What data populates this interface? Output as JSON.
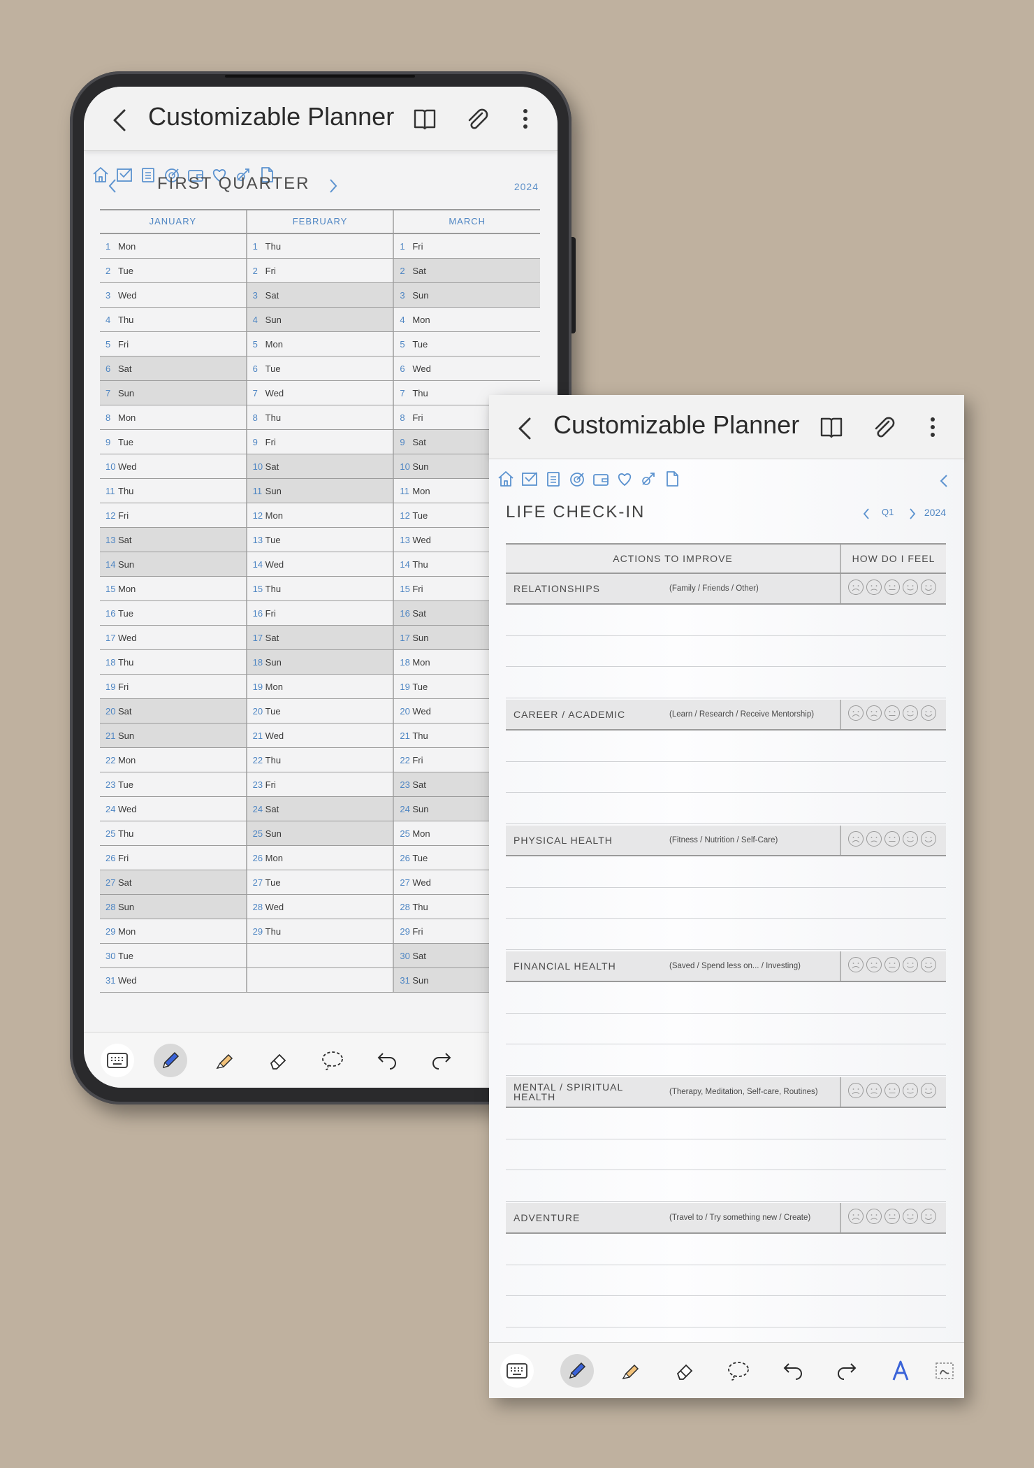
{
  "app_title": "Customizable Planner",
  "calendar": {
    "title": "FIRST QUARTER",
    "year": "2024",
    "months": [
      "JANUARY",
      "FEBRUARY",
      "MARCH"
    ],
    "rows": [
      [
        [
          "1",
          "Mon",
          false
        ],
        [
          "1",
          "Thu",
          false
        ],
        [
          "1",
          "Fri",
          false
        ]
      ],
      [
        [
          "2",
          "Tue",
          false
        ],
        [
          "2",
          "Fri",
          false
        ],
        [
          "2",
          "Sat",
          true
        ]
      ],
      [
        [
          "3",
          "Wed",
          false
        ],
        [
          "3",
          "Sat",
          true
        ],
        [
          "3",
          "Sun",
          true
        ]
      ],
      [
        [
          "4",
          "Thu",
          false
        ],
        [
          "4",
          "Sun",
          true
        ],
        [
          "4",
          "Mon",
          false
        ]
      ],
      [
        [
          "5",
          "Fri",
          false
        ],
        [
          "5",
          "Mon",
          false
        ],
        [
          "5",
          "Tue",
          false
        ]
      ],
      [
        [
          "6",
          "Sat",
          true
        ],
        [
          "6",
          "Tue",
          false
        ],
        [
          "6",
          "Wed",
          false
        ]
      ],
      [
        [
          "7",
          "Sun",
          true
        ],
        [
          "7",
          "Wed",
          false
        ],
        [
          "7",
          "Thu",
          false
        ]
      ],
      [
        [
          "8",
          "Mon",
          false
        ],
        [
          "8",
          "Thu",
          false
        ],
        [
          "8",
          "Fri",
          false
        ]
      ],
      [
        [
          "9",
          "Tue",
          false
        ],
        [
          "9",
          "Fri",
          false
        ],
        [
          "9",
          "Sat",
          true
        ]
      ],
      [
        [
          "10",
          "Wed",
          false
        ],
        [
          "10",
          "Sat",
          true
        ],
        [
          "10",
          "Sun",
          true
        ]
      ],
      [
        [
          "11",
          "Thu",
          false
        ],
        [
          "11",
          "Sun",
          true
        ],
        [
          "11",
          "Mon",
          false
        ]
      ],
      [
        [
          "12",
          "Fri",
          false
        ],
        [
          "12",
          "Mon",
          false
        ],
        [
          "12",
          "Tue",
          false
        ]
      ],
      [
        [
          "13",
          "Sat",
          true
        ],
        [
          "13",
          "Tue",
          false
        ],
        [
          "13",
          "Wed",
          false
        ]
      ],
      [
        [
          "14",
          "Sun",
          true
        ],
        [
          "14",
          "Wed",
          false
        ],
        [
          "14",
          "Thu",
          false
        ]
      ],
      [
        [
          "15",
          "Mon",
          false
        ],
        [
          "15",
          "Thu",
          false
        ],
        [
          "15",
          "Fri",
          false
        ]
      ],
      [
        [
          "16",
          "Tue",
          false
        ],
        [
          "16",
          "Fri",
          false
        ],
        [
          "16",
          "Sat",
          true
        ]
      ],
      [
        [
          "17",
          "Wed",
          false
        ],
        [
          "17",
          "Sat",
          true
        ],
        [
          "17",
          "Sun",
          true
        ]
      ],
      [
        [
          "18",
          "Thu",
          false
        ],
        [
          "18",
          "Sun",
          true
        ],
        [
          "18",
          "Mon",
          false
        ]
      ],
      [
        [
          "19",
          "Fri",
          false
        ],
        [
          "19",
          "Mon",
          false
        ],
        [
          "19",
          "Tue",
          false
        ]
      ],
      [
        [
          "20",
          "Sat",
          true
        ],
        [
          "20",
          "Tue",
          false
        ],
        [
          "20",
          "Wed",
          false
        ]
      ],
      [
        [
          "21",
          "Sun",
          true
        ],
        [
          "21",
          "Wed",
          false
        ],
        [
          "21",
          "Thu",
          false
        ]
      ],
      [
        [
          "22",
          "Mon",
          false
        ],
        [
          "22",
          "Thu",
          false
        ],
        [
          "22",
          "Fri",
          false
        ]
      ],
      [
        [
          "23",
          "Tue",
          false
        ],
        [
          "23",
          "Fri",
          false
        ],
        [
          "23",
          "Sat",
          true
        ]
      ],
      [
        [
          "24",
          "Wed",
          false
        ],
        [
          "24",
          "Sat",
          true
        ],
        [
          "24",
          "Sun",
          true
        ]
      ],
      [
        [
          "25",
          "Thu",
          false
        ],
        [
          "25",
          "Sun",
          true
        ],
        [
          "25",
          "Mon",
          false
        ]
      ],
      [
        [
          "26",
          "Fri",
          false
        ],
        [
          "26",
          "Mon",
          false
        ],
        [
          "26",
          "Tue",
          false
        ]
      ],
      [
        [
          "27",
          "Sat",
          true
        ],
        [
          "27",
          "Tue",
          false
        ],
        [
          "27",
          "Wed",
          false
        ]
      ],
      [
        [
          "28",
          "Sun",
          true
        ],
        [
          "28",
          "Wed",
          false
        ],
        [
          "28",
          "Thu",
          false
        ]
      ],
      [
        [
          "29",
          "Mon",
          false
        ],
        [
          "29",
          "Thu",
          false
        ],
        [
          "29",
          "Fri",
          false
        ]
      ],
      [
        [
          "30",
          "Tue",
          false
        ],
        [
          "",
          "",
          false
        ],
        [
          "30",
          "Sat",
          true
        ]
      ],
      [
        [
          "31",
          "Wed",
          false
        ],
        [
          "",
          "",
          false
        ],
        [
          "31",
          "Sun",
          true
        ]
      ]
    ]
  },
  "checkin": {
    "title": "LIFE CHECK-IN",
    "quarter": "Q1",
    "year": "2024",
    "col_actions": "ACTIONS TO IMPROVE",
    "col_feel": "HOW DO I FEEL",
    "sections": [
      {
        "name": "RELATIONSHIPS",
        "hint": "(Family / Friends / Other)"
      },
      {
        "name": "CAREER / ACADEMIC",
        "hint": "(Learn / Research / Receive Mentorship)"
      },
      {
        "name": "PHYSICAL HEALTH",
        "hint": "(Fitness / Nutrition / Self-Care)"
      },
      {
        "name": "FINANCIAL HEALTH",
        "hint": "(Saved / Spend less on... / Investing)"
      },
      {
        "name": "MENTAL / SPIRITUAL HEALTH",
        "hint": "(Therapy, Meditation, Self-care, Routines)"
      },
      {
        "name": "ADVENTURE",
        "hint": "(Travel to / Try something new / Create)"
      }
    ]
  },
  "nav_icons": [
    "home-icon",
    "inbox-check-icon",
    "clipboard-icon",
    "goal-icon",
    "wallet-icon",
    "heart-icon",
    "habit-icon",
    "page-icon"
  ],
  "toolbar_tools": [
    "keyboard-icon",
    "pen-icon",
    "highlighter-icon",
    "eraser-icon",
    "lasso-icon",
    "undo-icon",
    "redo-icon",
    "text-style-icon",
    "text-recognition-icon"
  ],
  "colors": {
    "accent": "#4f86c3",
    "pen": "#3a63d8",
    "highlighter": "#f2c27a",
    "background": "#bfb19f"
  }
}
